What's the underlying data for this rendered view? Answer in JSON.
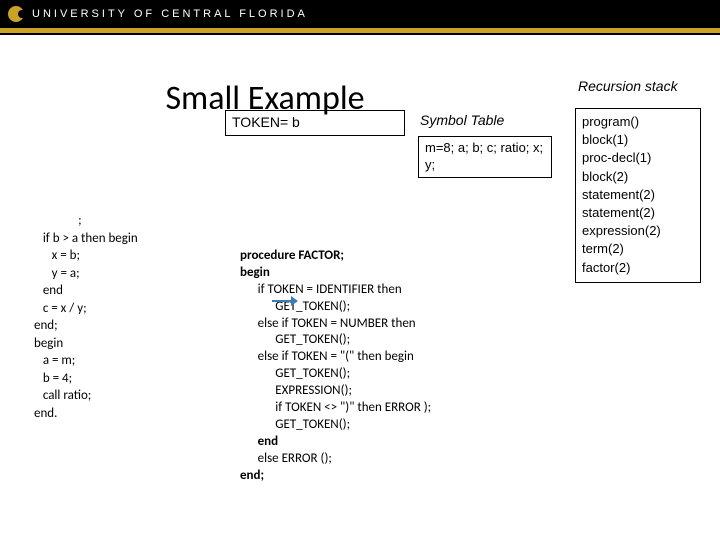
{
  "header": {
    "org": "UNIVERSITY OF CENTRAL FLORIDA"
  },
  "title": "Small Example",
  "token_box": "TOKEN= b",
  "symbol_table": {
    "label": "Symbol Table",
    "content": "m=8; a; b; c; ratio; x; y;"
  },
  "stack": {
    "label": "Recursion stack",
    "items": [
      "program()",
      "block(1)",
      "proc-decl(1)",
      "block(2)",
      "statement(2)",
      "statement(2)",
      "expression(2)",
      "term(2)",
      "factor(2)"
    ]
  },
  "code_left": "               ;\n   if b > a then begin\n      x = b;\n      y = a;\n   end\n   c = x / y;\nend;\nbegin\n   a = m;\n   b = 4;\n   call ratio;\nend.",
  "code_right": {
    "l0": "procedure FACTOR;",
    "l1": "begin",
    "l2": "      if TOKEN = IDENTIFIER then",
    "l3": "            GET_TOKEN();",
    "l4": "      else if TOKEN = NUMBER then",
    "l5": "            GET_TOKEN();",
    "l6": "      else if TOKEN = \"(\" then begin",
    "l7": "            GET_TOKEN();",
    "l8": "            EXPRESSION();",
    "l9": "            if TOKEN <> \")\" then ERROR );",
    "l10": "            GET_TOKEN();",
    "l11": "      end",
    "l12": "      else ERROR ();",
    "l13": "end;"
  }
}
